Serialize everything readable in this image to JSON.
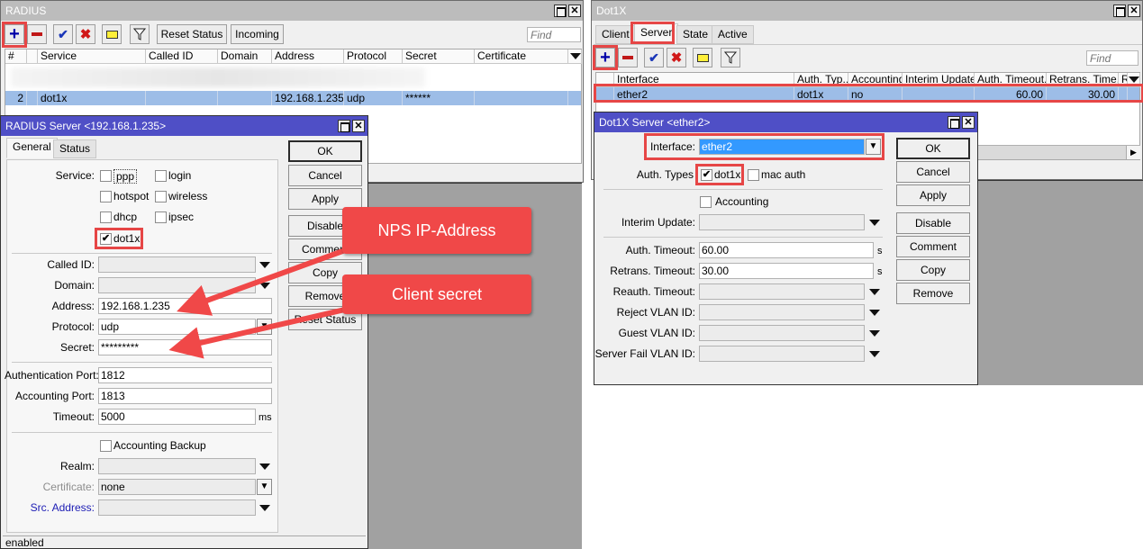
{
  "radius_window": {
    "title": "RADIUS",
    "toolbar": {
      "add_icon": "plus-icon",
      "remove_icon": "minus-icon",
      "enable_icon": "check-icon",
      "disable_icon": "cross-icon",
      "comment_icon": "note-icon",
      "filter_icon": "filter-icon",
      "reset_status_label": "Reset Status",
      "incoming_label": "Incoming",
      "find_placeholder": "Find"
    },
    "columns": [
      "#",
      "",
      "Service",
      "Called ID",
      "Domain",
      "Address",
      "Protocol",
      "Secret",
      "Certificate"
    ],
    "rows": [
      {
        "num": "2",
        "flag": "",
        "service": "dot1x",
        "called_id": "",
        "domain": "",
        "address": "192.168.1.235",
        "protocol": "udp",
        "secret": "******",
        "certificate": ""
      }
    ]
  },
  "radius_server_dialog": {
    "title": "RADIUS Server <192.168.1.235>",
    "tabs": [
      {
        "label": "General"
      },
      {
        "label": "Status"
      }
    ],
    "service_label": "Service:",
    "services": [
      {
        "label": "ppp",
        "checked": false
      },
      {
        "label": "login",
        "checked": false
      },
      {
        "label": "hotspot",
        "checked": false
      },
      {
        "label": "wireless",
        "checked": false
      },
      {
        "label": "dhcp",
        "checked": false
      },
      {
        "label": "ipsec",
        "checked": false
      },
      {
        "label": "dot1x",
        "checked": true
      }
    ],
    "fields": {
      "called_id": {
        "label": "Called ID:",
        "value": ""
      },
      "domain": {
        "label": "Domain:",
        "value": ""
      },
      "address": {
        "label": "Address:",
        "value": "192.168.1.235"
      },
      "protocol": {
        "label": "Protocol:",
        "value": "udp"
      },
      "secret": {
        "label": "Secret:",
        "value": "*********"
      },
      "auth_port": {
        "label": "Authentication Port:",
        "value": "1812"
      },
      "acct_port": {
        "label": "Accounting Port:",
        "value": "1813"
      },
      "timeout": {
        "label": "Timeout:",
        "value": "5000",
        "unit": "ms"
      },
      "accounting_backup": {
        "label": "Accounting Backup",
        "checked": false
      },
      "realm": {
        "label": "Realm:",
        "value": ""
      },
      "certificate": {
        "label": "Certificate:",
        "value": "none"
      },
      "src_address": {
        "label": "Src. Address:",
        "value": ""
      }
    },
    "buttons": {
      "ok": "OK",
      "cancel": "Cancel",
      "apply": "Apply",
      "disable": "Disable",
      "comment": "Comment",
      "copy": "Copy",
      "remove": "Remove",
      "reset_status": "Reset Status"
    },
    "status_bar": "enabled"
  },
  "callouts": {
    "nps_ip": "NPS IP-Address",
    "client_secret": "Client secret"
  },
  "dot1x_window": {
    "title": "Dot1X",
    "tabs": [
      {
        "label": "Client"
      },
      {
        "label": "Server"
      },
      {
        "label": "State"
      },
      {
        "label": "Active"
      }
    ],
    "active_tab": "Server",
    "toolbar": {
      "find_placeholder": "Find"
    },
    "columns": [
      "",
      "Interface",
      "Auth. Typ...",
      "Accounting",
      "Interim Update",
      "Auth. Timeout...",
      "Retrans. Time...",
      "R"
    ],
    "rows": [
      {
        "interface": "ether2",
        "auth_types": "dot1x",
        "accounting": "no",
        "interim_update": "",
        "auth_timeout": "60.00",
        "retrans_timeout": "30.00",
        "r": ""
      }
    ]
  },
  "dot1x_server_dialog": {
    "title": "Dot1X Server <ether2>",
    "fields": {
      "interface": {
        "label": "Interface:",
        "value": "ether2"
      },
      "auth_types": {
        "label": "Auth. Types",
        "options": [
          {
            "label": "dot1x",
            "checked": true
          },
          {
            "label": "mac auth",
            "checked": false
          }
        ]
      },
      "accounting": {
        "label": "Accounting",
        "checked": false
      },
      "interim_update": {
        "label": "Interim Update:",
        "value": ""
      },
      "auth_timeout": {
        "label": "Auth. Timeout:",
        "value": "60.00",
        "unit": "s"
      },
      "retrans_timeout": {
        "label": "Retrans. Timeout:",
        "value": "30.00",
        "unit": "s"
      },
      "reauth_timeout": {
        "label": "Reauth. Timeout:",
        "value": ""
      },
      "reject_vlan": {
        "label": "Reject VLAN ID:",
        "value": ""
      },
      "guest_vlan": {
        "label": "Guest VLAN ID:",
        "value": ""
      },
      "server_fail_vlan": {
        "label": "Server Fail VLAN ID:",
        "value": ""
      }
    },
    "buttons": {
      "ok": "OK",
      "cancel": "Cancel",
      "apply": "Apply",
      "disable": "Disable",
      "comment": "Comment",
      "copy": "Copy",
      "remove": "Remove"
    }
  },
  "colors": {
    "highlight_red": "#e64646",
    "title_active": "#4f4fc6",
    "row_selected": "#9dbde7",
    "callout_bg": "#f04848"
  }
}
